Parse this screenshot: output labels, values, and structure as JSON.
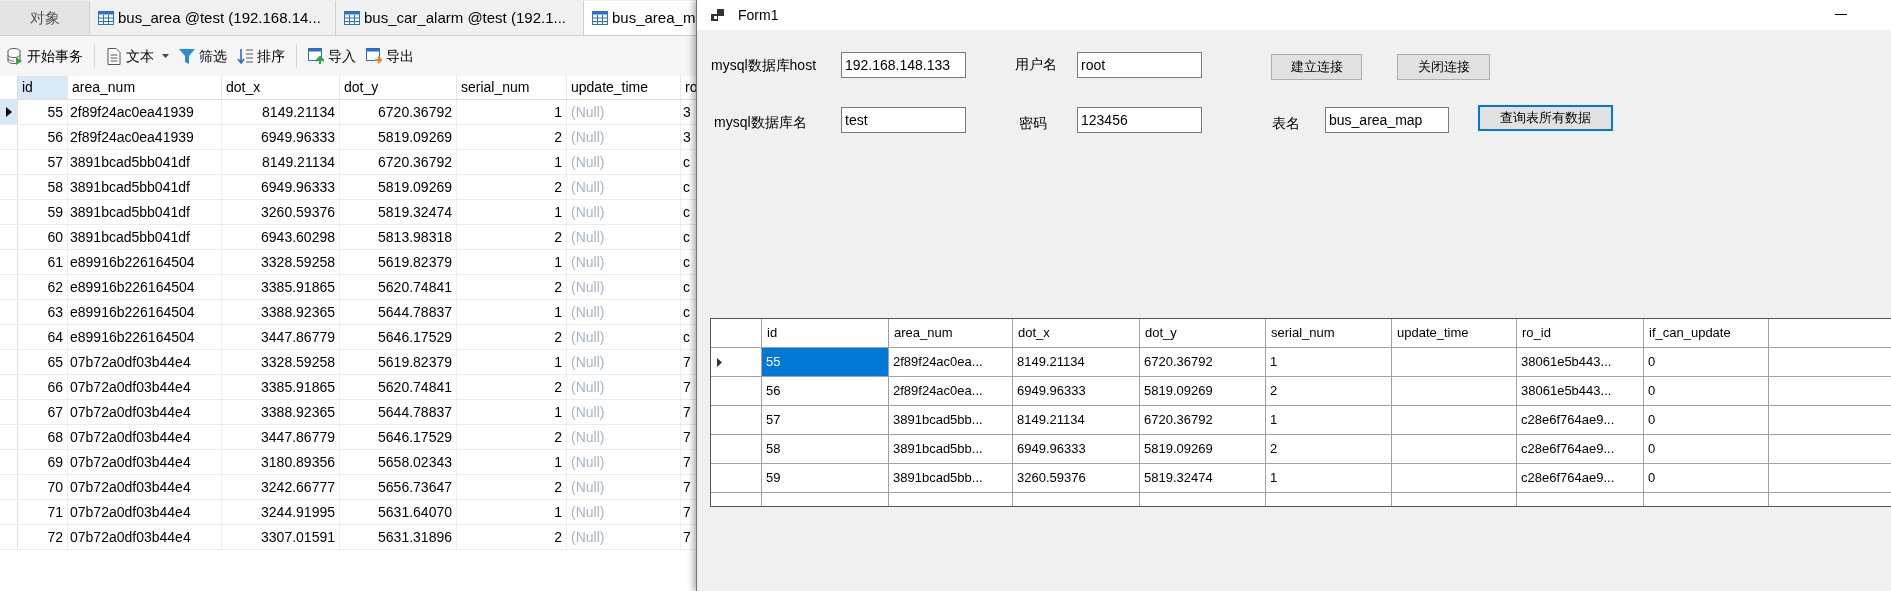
{
  "navicat": {
    "tabs": [
      {
        "label": "对象",
        "selected": false,
        "kind": "plain"
      },
      {
        "label": "bus_area @test (192.168.14...",
        "selected": false,
        "kind": "table"
      },
      {
        "label": "bus_car_alarm @test (192.1...",
        "selected": false,
        "kind": "table"
      },
      {
        "label": "bus_area_m",
        "selected": true,
        "kind": "table"
      }
    ],
    "toolbar": [
      {
        "label": "开始事务",
        "kind": "database"
      },
      {
        "label": "文本",
        "kind": "document"
      },
      {
        "label": "筛选",
        "kind": "filter"
      },
      {
        "label": "排序",
        "kind": "sort"
      },
      {
        "label": "导入",
        "kind": "import"
      },
      {
        "label": "导出",
        "kind": "export"
      }
    ],
    "table": {
      "columns": [
        {
          "label": "id",
          "kind": "number",
          "selected": true
        },
        {
          "label": "area_num",
          "kind": "text",
          "selected": false
        },
        {
          "label": "dot_x",
          "kind": "number",
          "selected": false
        },
        {
          "label": "dot_y",
          "kind": "number",
          "selected": false
        },
        {
          "label": "serial_num",
          "kind": "number",
          "selected": false
        },
        {
          "label": "update_time",
          "kind": "null",
          "selected": false
        },
        {
          "label": "ro",
          "kind": "text",
          "selected": false
        }
      ],
      "rows": [
        {
          "selected": true,
          "cells": [
            "55",
            "2f89f24ac0ea41939",
            "8149.21134",
            "6720.36792",
            "1",
            "(Null)",
            "3"
          ]
        },
        {
          "selected": false,
          "cells": [
            "56",
            "2f89f24ac0ea41939",
            "6949.96333",
            "5819.09269",
            "2",
            "(Null)",
            "3"
          ]
        },
        {
          "selected": false,
          "cells": [
            "57",
            "3891bcad5bb041df",
            "8149.21134",
            "6720.36792",
            "1",
            "(Null)",
            "c"
          ]
        },
        {
          "selected": false,
          "cells": [
            "58",
            "3891bcad5bb041df",
            "6949.96333",
            "5819.09269",
            "2",
            "(Null)",
            "c"
          ]
        },
        {
          "selected": false,
          "cells": [
            "59",
            "3891bcad5bb041df",
            "3260.59376",
            "5819.32474",
            "1",
            "(Null)",
            "c"
          ]
        },
        {
          "selected": false,
          "cells": [
            "60",
            "3891bcad5bb041df",
            "6943.60298",
            "5813.98318",
            "2",
            "(Null)",
            "c"
          ]
        },
        {
          "selected": false,
          "cells": [
            "61",
            "e89916b226164504",
            "3328.59258",
            "5619.82379",
            "1",
            "(Null)",
            "c"
          ]
        },
        {
          "selected": false,
          "cells": [
            "62",
            "e89916b226164504",
            "3385.91865",
            "5620.74841",
            "2",
            "(Null)",
            "c"
          ]
        },
        {
          "selected": false,
          "cells": [
            "63",
            "e89916b226164504",
            "3388.92365",
            "5644.78837",
            "1",
            "(Null)",
            "c"
          ]
        },
        {
          "selected": false,
          "cells": [
            "64",
            "e89916b226164504",
            "3447.86779",
            "5646.17529",
            "2",
            "(Null)",
            "c"
          ]
        },
        {
          "selected": false,
          "cells": [
            "65",
            "07b72a0df03b44e4",
            "3328.59258",
            "5619.82379",
            "1",
            "(Null)",
            "7"
          ]
        },
        {
          "selected": false,
          "cells": [
            "66",
            "07b72a0df03b44e4",
            "3385.91865",
            "5620.74841",
            "2",
            "(Null)",
            "7"
          ]
        },
        {
          "selected": false,
          "cells": [
            "67",
            "07b72a0df03b44e4",
            "3388.92365",
            "5644.78837",
            "1",
            "(Null)",
            "7"
          ]
        },
        {
          "selected": false,
          "cells": [
            "68",
            "07b72a0df03b44e4",
            "3447.86779",
            "5646.17529",
            "2",
            "(Null)",
            "7"
          ]
        },
        {
          "selected": false,
          "cells": [
            "69",
            "07b72a0df03b44e4",
            "3180.89356",
            "5658.02343",
            "1",
            "(Null)",
            "7"
          ]
        },
        {
          "selected": false,
          "cells": [
            "70",
            "07b72a0df03b44e4",
            "3242.66777",
            "5656.73647",
            "2",
            "(Null)",
            "7"
          ]
        },
        {
          "selected": false,
          "cells": [
            "71",
            "07b72a0df03b44e4",
            "3244.91995",
            "5631.64070",
            "1",
            "(Null)",
            "7"
          ]
        },
        {
          "selected": false,
          "cells": [
            "72",
            "07b72a0df03b44e4",
            "3307.01591",
            "5631.31896",
            "2",
            "(Null)",
            "7"
          ]
        }
      ]
    }
  },
  "form": {
    "title": "Form1",
    "fields": [
      {
        "label": "mysql数据库host",
        "value": "192.168.148.133"
      },
      {
        "label": "用户名",
        "value": "root"
      },
      {
        "label": "mysql数据库名",
        "value": "test"
      },
      {
        "label": "密码",
        "value": "123456"
      },
      {
        "label": "表名",
        "value": "bus_area_map"
      }
    ],
    "buttons": [
      {
        "label": "建立连接",
        "focused": false
      },
      {
        "label": "关闭连接",
        "focused": false
      },
      {
        "label": "查询表所有数据",
        "focused": true
      }
    ],
    "grid": {
      "columns": [
        "id",
        "area_num",
        "dot_x",
        "dot_y",
        "serial_num",
        "update_time",
        "ro_id",
        "if_can_update"
      ],
      "rows": [
        {
          "selected": true,
          "cells": [
            "55",
            "2f89f24ac0ea...",
            "8149.21134",
            "6720.36792",
            "1",
            "",
            "38061e5b443...",
            "0"
          ]
        },
        {
          "selected": false,
          "cells": [
            "56",
            "2f89f24ac0ea...",
            "6949.96333",
            "5819.09269",
            "2",
            "",
            "38061e5b443...",
            "0"
          ]
        },
        {
          "selected": false,
          "cells": [
            "57",
            "3891bcad5bb...",
            "8149.21134",
            "6720.36792",
            "1",
            "",
            "c28e6f764ae9...",
            "0"
          ]
        },
        {
          "selected": false,
          "cells": [
            "58",
            "3891bcad5bb...",
            "6949.96333",
            "5819.09269",
            "2",
            "",
            "c28e6f764ae9...",
            "0"
          ]
        },
        {
          "selected": false,
          "cells": [
            "59",
            "3891bcad5bb...",
            "3260.59376",
            "5819.32474",
            "1",
            "",
            "c28e6f764ae9...",
            "0"
          ]
        }
      ]
    }
  }
}
